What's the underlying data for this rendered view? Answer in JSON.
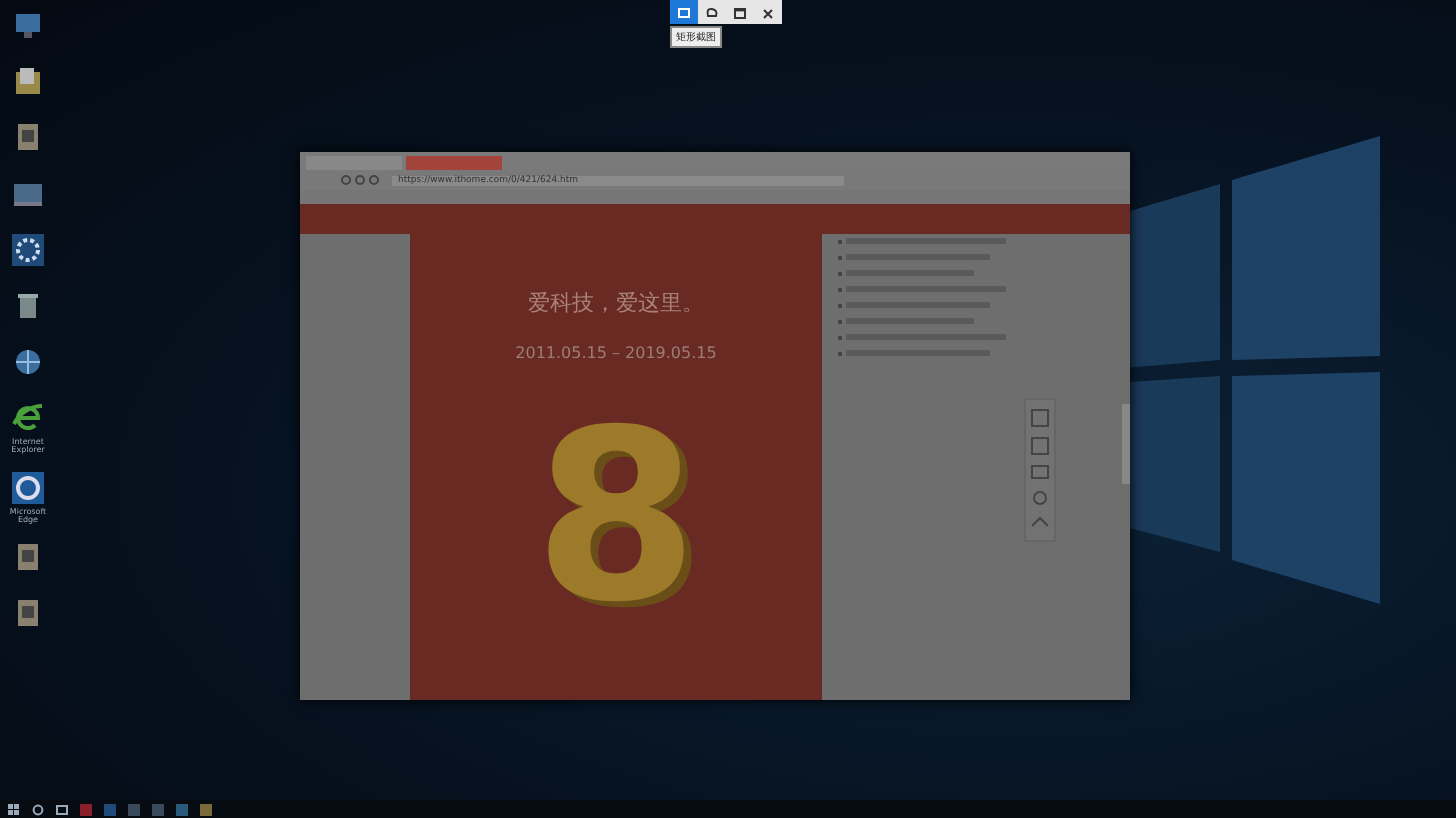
{
  "snip_toolbar": {
    "buttons": [
      {
        "kind": "rect",
        "selected": true
      },
      {
        "kind": "free",
        "selected": false
      },
      {
        "kind": "window",
        "selected": false
      },
      {
        "kind": "close",
        "selected": false
      }
    ],
    "tooltip": "矩形截图"
  },
  "desktop_icons": [
    {
      "kind": "pc"
    },
    {
      "kind": "folder"
    },
    {
      "kind": "file"
    },
    {
      "kind": "monitor"
    },
    {
      "kind": "gear"
    },
    {
      "kind": "bin"
    },
    {
      "kind": "network"
    },
    {
      "kind": "ie",
      "label": "Internet Explorer"
    },
    {
      "kind": "edge",
      "label": "Microsoft Edge"
    },
    {
      "kind": "file"
    },
    {
      "kind": "file"
    }
  ],
  "browser": {
    "address": "https://www.ithome.com/0/421/624.htm",
    "banner": {
      "headline": "爱科技，爱这里。",
      "dates": "2011.05.15 – 2019.05.15",
      "number": "8"
    }
  },
  "taskbar": {
    "apps": [
      {
        "kind": "start"
      },
      {
        "kind": "search"
      },
      {
        "kind": "tasks"
      },
      {
        "kind": "app",
        "color": "#8a1f2a"
      },
      {
        "kind": "app",
        "color": "#1f4a7a"
      },
      {
        "kind": "app",
        "color": "#3a4a5a"
      },
      {
        "kind": "app",
        "color": "#3a4a5a"
      },
      {
        "kind": "app",
        "color": "#2a5a7a"
      },
      {
        "kind": "app",
        "color": "#7a6a3a"
      }
    ]
  }
}
